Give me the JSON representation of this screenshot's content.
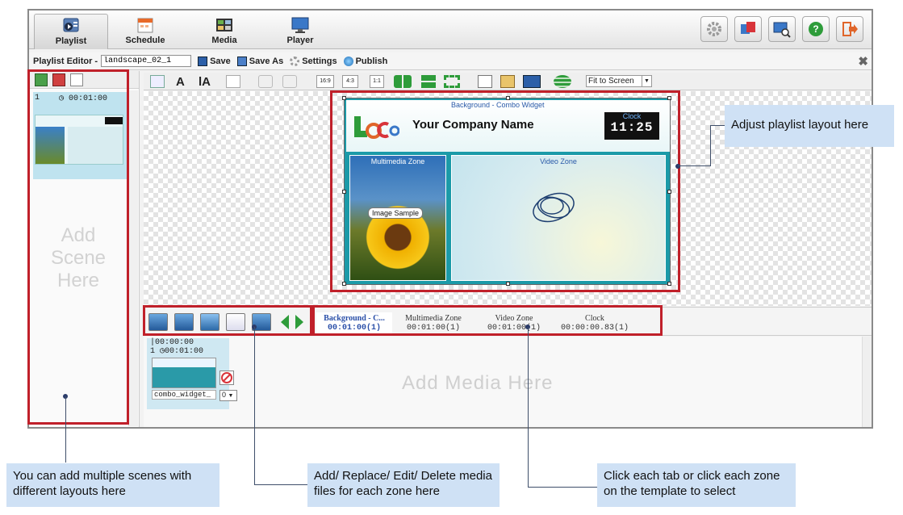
{
  "topnav": {
    "tabs": [
      {
        "label": "Playlist",
        "active": true
      },
      {
        "label": "Schedule"
      },
      {
        "label": "Media"
      },
      {
        "label": "Player"
      }
    ],
    "right_icons": [
      "gear-icon",
      "display-icon",
      "monitor-search-icon",
      "help-icon",
      "logout-icon"
    ]
  },
  "editor": {
    "title": "Playlist Editor -",
    "playlist_name": "landscape_02_1",
    "save": "Save",
    "save_as": "Save As",
    "settings": "Settings",
    "publish": "Publish",
    "close": "✖"
  },
  "scenes": {
    "item": {
      "index": "1",
      "duration": "00:01:00"
    },
    "placeholder_lines": [
      "Add",
      "Scene",
      "Here"
    ]
  },
  "toolbar": {
    "ratios": [
      "16:9",
      "4:3",
      "1:1"
    ],
    "zoom": "Fit to Screen"
  },
  "template": {
    "bg_title": "Background - Combo Widget",
    "company": "Your Company Name",
    "clock_title": "Clock",
    "clock_value": "11:25",
    "mm_zone_title": "Multimedia Zone",
    "image_sample": "Image Sample",
    "video_zone_title": "Video Zone"
  },
  "zone_tabs": [
    {
      "name": "Background - C...",
      "time": "00:01:00(1)",
      "active": true
    },
    {
      "name": "Multimedia Zone",
      "time": "00:01:00(1)"
    },
    {
      "name": "Video Zone",
      "time": "00:01:00(1)"
    },
    {
      "name": "Clock",
      "time": "00:00:00.83(1)"
    }
  ],
  "media": {
    "item": {
      "start": "|00:00:00",
      "index": "1",
      "duration": "00:01:00",
      "name": "combo_widget_",
      "select_value": "0"
    },
    "placeholder": "Add Media Here"
  },
  "callouts": {
    "layout": "Adjust playlist layout here",
    "scenes": "You can add multiple scenes with different layouts here",
    "media": "Add/ Replace/ Edit/ Delete media files for each zone here",
    "tabs": "Click each tab or click each zone on the template to select"
  },
  "colors": {
    "highlight": "#c0202a",
    "callout_bg": "#cfe1f5",
    "teal": "#1b9aa8"
  }
}
